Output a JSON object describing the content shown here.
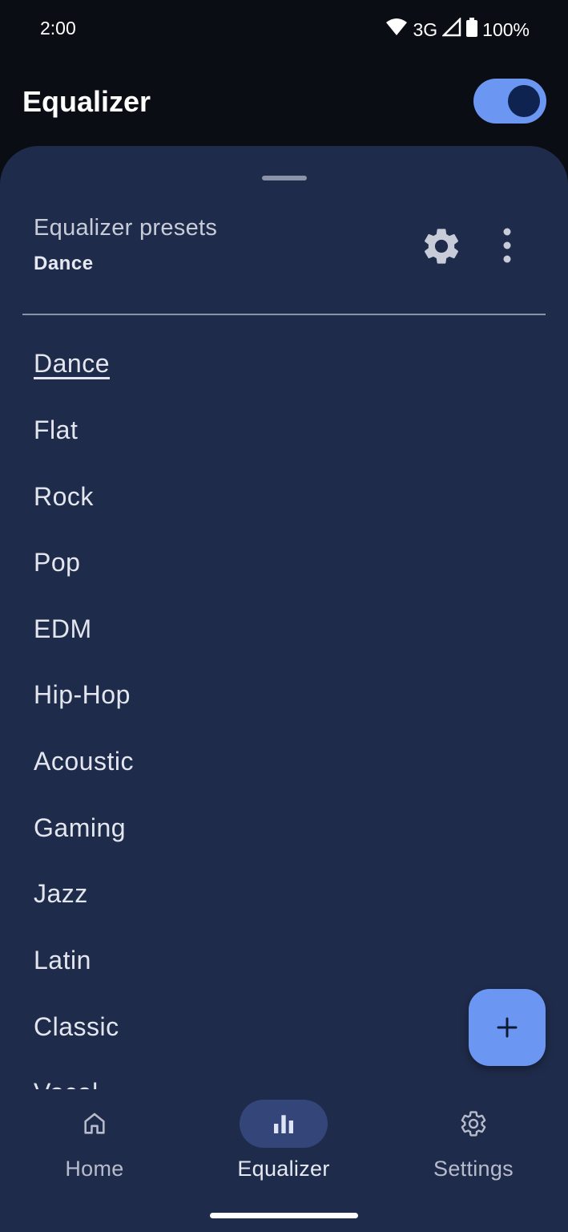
{
  "status_bar": {
    "time": "2:00",
    "network": "3G",
    "battery": "100%"
  },
  "app_bar": {
    "title": "Equalizer",
    "switch_on": true
  },
  "presets": {
    "header_label": "Equalizer presets",
    "selected": "Dance",
    "items": [
      {
        "label": "Dance"
      },
      {
        "label": "Flat"
      },
      {
        "label": "Rock"
      },
      {
        "label": "Pop"
      },
      {
        "label": "EDM"
      },
      {
        "label": "Hip-Hop"
      },
      {
        "label": "Acoustic"
      },
      {
        "label": "Gaming"
      },
      {
        "label": "Jazz"
      },
      {
        "label": "Latin"
      },
      {
        "label": "Classic"
      },
      {
        "label": "Vocal"
      }
    ]
  },
  "bottom_nav": {
    "items": [
      {
        "label": "Home",
        "icon": "home-icon"
      },
      {
        "label": "Equalizer",
        "icon": "equalizer-icon"
      },
      {
        "label": "Settings",
        "icon": "gear-icon"
      }
    ],
    "active": "Equalizer"
  },
  "colors": {
    "sheet_bg": "#1f2b4a",
    "accent": "#6b96f2",
    "nav_active_pill": "#34457a"
  }
}
